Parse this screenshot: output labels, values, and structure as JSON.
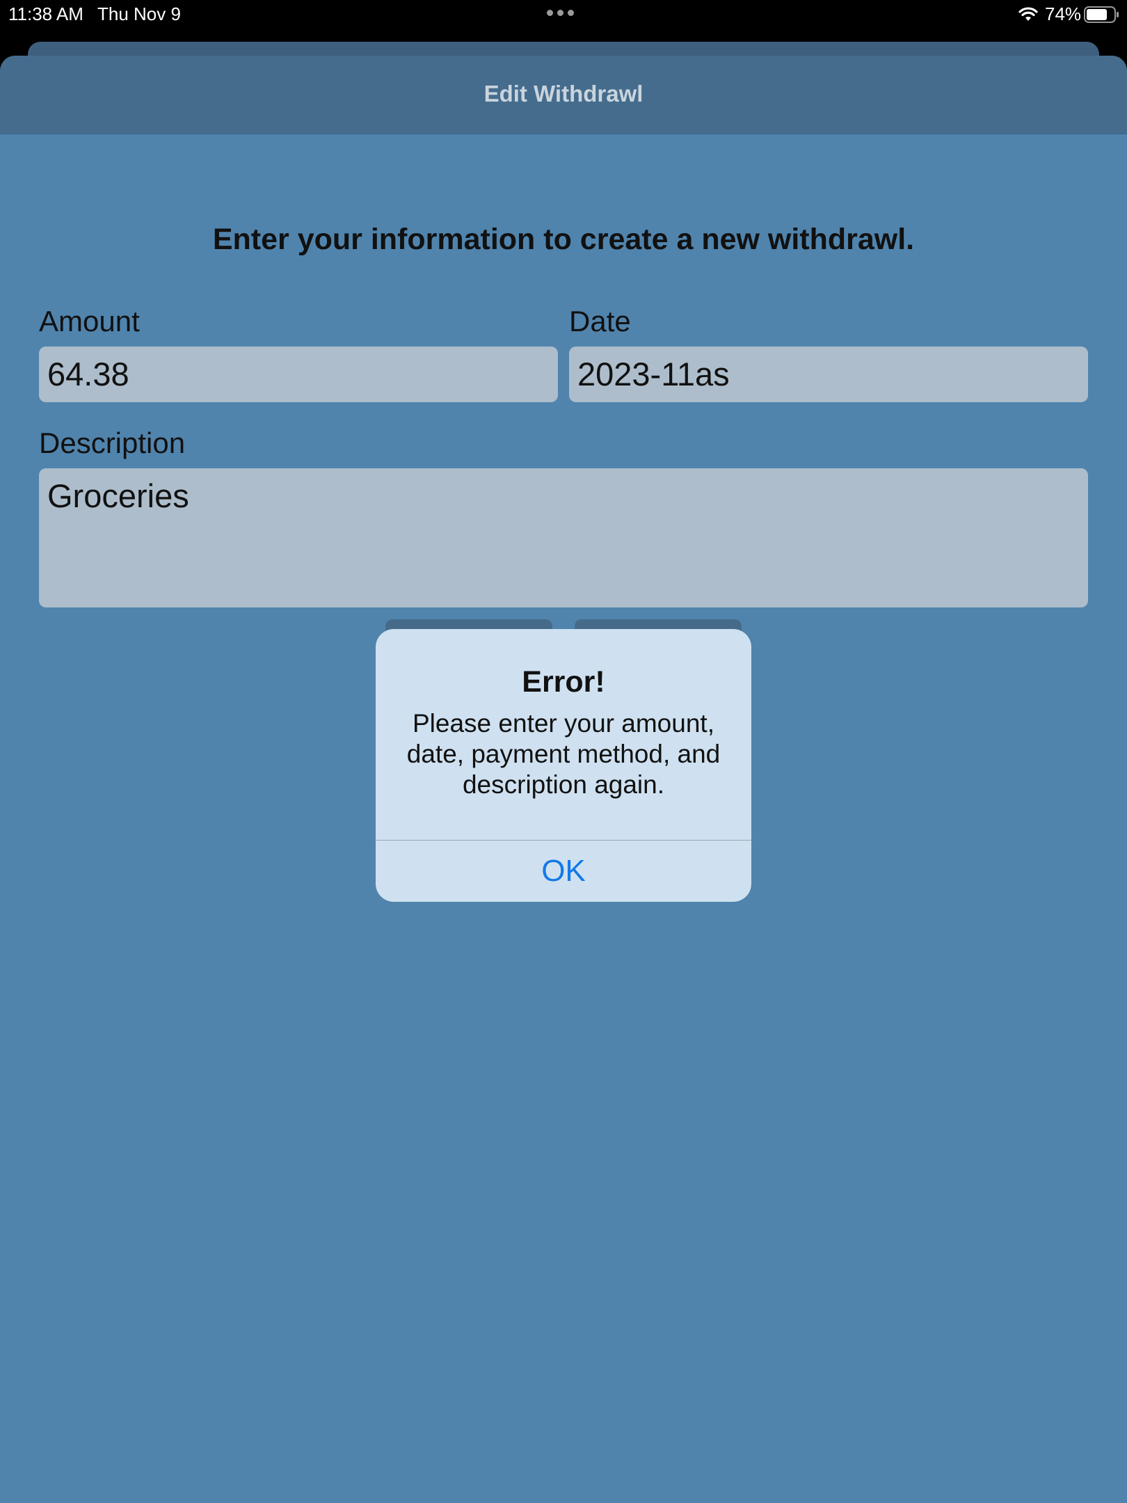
{
  "status_bar": {
    "time": "11:38 AM",
    "date": "Thu Nov 9",
    "battery_percent": "74%",
    "icons": [
      "wifi-icon",
      "battery-icon",
      "multitasking-dots-icon"
    ]
  },
  "nav": {
    "title": "Edit Withdrawl"
  },
  "form": {
    "instruction": "Enter your information to create a new withdrawl.",
    "amount_label": "Amount",
    "amount_value": "64.38",
    "date_label": "Date",
    "date_value": "2023-11as",
    "description_label": "Description",
    "description_value": "Groceries"
  },
  "alert": {
    "title": "Error!",
    "message": "Please enter your amount, date, payment method, and description again.",
    "ok_label": "OK"
  },
  "colors": {
    "sheet_background": "#5084ad",
    "nav_background": "#456c8d",
    "field_background": "#adbdcb",
    "alert_background": "#cfe1f0",
    "accent": "#1479e6"
  }
}
